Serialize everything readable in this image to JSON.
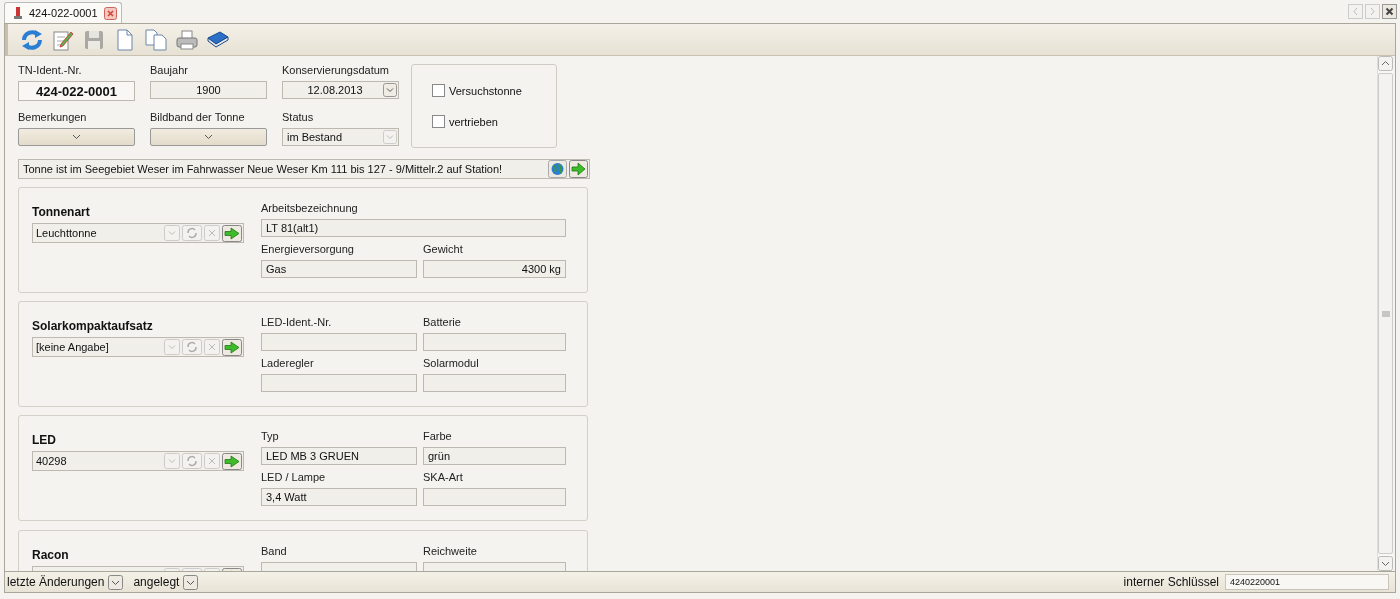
{
  "tab": {
    "title": "424-022-0001"
  },
  "toolbar": [
    {
      "kind": "refresh",
      "disabled": false
    },
    {
      "kind": "edit",
      "disabled": false
    },
    {
      "kind": "save",
      "disabled": true
    },
    {
      "kind": "new",
      "disabled": false
    },
    {
      "kind": "copy",
      "disabled": false
    },
    {
      "kind": "print",
      "disabled": false
    },
    {
      "kind": "book",
      "disabled": false
    }
  ],
  "header_fields": [
    {
      "label": "TN-Ident.-Nr.",
      "value": "424-022-0001",
      "kind": "ident"
    },
    {
      "label": "Baujahr",
      "value": "1900",
      "kind": "centered"
    },
    {
      "label": "Konservierungsdatum",
      "value": "12.08.2013",
      "kind": "date"
    },
    {
      "label": "Bemerkungen",
      "kind": "dropdown"
    },
    {
      "label": "Bildband der Tonne",
      "kind": "dropdown"
    },
    {
      "label": "Status",
      "value": "im Bestand",
      "kind": "select"
    }
  ],
  "checkboxes": [
    {
      "label": "Versuchstonne",
      "checked": false
    },
    {
      "label": "vertrieben",
      "checked": false
    }
  ],
  "location_note": "Tonne ist im Seegebiet Weser im Fahrwasser Neue Weser Km 111 bis 127 - 9/Mittelr.2 auf Station!",
  "sections": [
    {
      "title": "Tonnenart",
      "value": "Leuchttonne",
      "fields": [
        {
          "label": "Arbeitsbezeichnung",
          "value": "LT 81(alt1)",
          "kind": "wide"
        },
        {
          "label": "Energieversorgung",
          "value": "Gas",
          "kind": "text"
        },
        {
          "label": "Gewicht",
          "value": "4300 kg",
          "kind": "number"
        }
      ]
    },
    {
      "title": "Solarkompaktaufsatz",
      "value": "[keine Angabe]",
      "fields": [
        {
          "label": "LED-Ident.-Nr.",
          "kind": "text"
        },
        {
          "label": "Batterie",
          "kind": "text"
        },
        {
          "label": "Laderegler",
          "kind": "text"
        },
        {
          "label": "Solarmodul",
          "kind": "text"
        }
      ]
    },
    {
      "title": "LED",
      "value": "40298",
      "fields": [
        {
          "label": "Typ",
          "value": "LED MB 3 GRUEN",
          "kind": "text"
        },
        {
          "label": "Farbe",
          "value": "grün",
          "kind": "text"
        },
        {
          "label": "LED / Lampe",
          "value": "3,4 Watt",
          "kind": "text"
        },
        {
          "label": "SKA-Art",
          "kind": "text"
        }
      ]
    },
    {
      "title": "Racon",
      "fields": [
        {
          "label": "Band",
          "kind": "text"
        },
        {
          "label": "Reichweite",
          "kind": "text"
        }
      ]
    }
  ],
  "status_bar": {
    "changes_label": "letzte Änderungen",
    "created_label": "angelegt",
    "key_label": "interner Schlüssel",
    "key_value": "4240220001"
  }
}
